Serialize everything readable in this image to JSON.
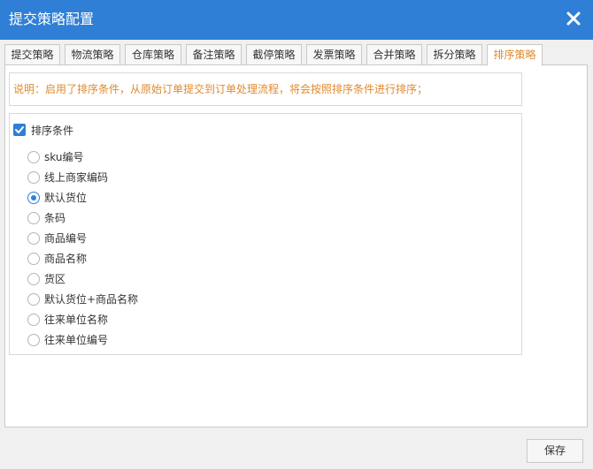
{
  "dialog": {
    "title": "提交策略配置"
  },
  "tabs": [
    {
      "label": "提交策略"
    },
    {
      "label": "物流策略"
    },
    {
      "label": "仓库策略"
    },
    {
      "label": "备注策略"
    },
    {
      "label": "截停策略"
    },
    {
      "label": "发票策略"
    },
    {
      "label": "合并策略"
    },
    {
      "label": "拆分策略"
    },
    {
      "label": "排序策略",
      "active": true
    }
  ],
  "notice": "说明：启用了排序条件，从原始订单提交到订单处理流程，将会按照排序条件进行排序；",
  "sort": {
    "enable_label": "排序条件",
    "enabled": true,
    "selected": "默认货位",
    "options": [
      {
        "label": "sku编号"
      },
      {
        "label": "线上商家编码"
      },
      {
        "label": "默认货位"
      },
      {
        "label": "条码"
      },
      {
        "label": "商品编号"
      },
      {
        "label": "商品名称"
      },
      {
        "label": "货区"
      },
      {
        "label": "默认货位+商品名称"
      },
      {
        "label": "往来单位名称"
      },
      {
        "label": "往来单位编号"
      }
    ]
  },
  "footer": {
    "save_label": "保存"
  },
  "colors": {
    "accent": "#2f7fd6",
    "warning_text": "#e08a2e"
  }
}
